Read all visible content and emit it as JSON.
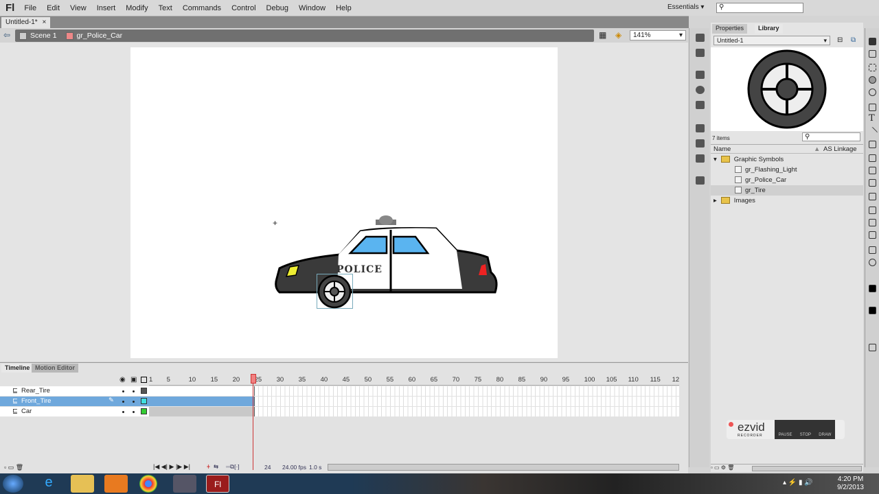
{
  "app": {
    "logo": "Fl",
    "menu": [
      "File",
      "Edit",
      "View",
      "Insert",
      "Modify",
      "Text",
      "Commands",
      "Control",
      "Debug",
      "Window",
      "Help"
    ],
    "workspace": "Essentials",
    "search_placeholder": ""
  },
  "document": {
    "tab": "Untitled-1*",
    "close": "×"
  },
  "editbar": {
    "scene": "Scene 1",
    "symbol": "gr_Police_Car",
    "zoom": "141%"
  },
  "stage": {
    "car_text": "POLICE"
  },
  "panel": {
    "tabs": [
      "Properties",
      "Library"
    ],
    "active_tab": "Library",
    "library_select": "Untitled-1",
    "item_count": "7 items",
    "columns": {
      "name": "Name",
      "linkage": "AS Linkage"
    },
    "items": [
      {
        "label": "Graphic Symbols",
        "type": "folder",
        "expanded": true
      },
      {
        "label": "gr_Flashing_Light",
        "type": "graphic"
      },
      {
        "label": "gr_Police_Car",
        "type": "graphic"
      },
      {
        "label": "gr_Tire",
        "type": "graphic",
        "selected": true
      },
      {
        "label": "Images",
        "type": "folder",
        "expanded": false
      }
    ]
  },
  "timeline": {
    "tabs": [
      "Timeline",
      "Motion Editor"
    ],
    "frame_numbers": [
      1,
      5,
      10,
      15,
      20,
      25,
      30,
      35,
      40,
      45,
      50,
      55,
      60,
      65,
      70,
      75,
      80,
      85,
      90,
      95,
      100,
      105,
      110,
      115,
      12
    ],
    "layers": [
      {
        "name": "Rear_Tire",
        "color": "#555555",
        "selected": false
      },
      {
        "name": "Front_Tire",
        "color": "#40e0e0",
        "selected": true
      },
      {
        "name": "Car",
        "color": "#33cc33",
        "selected": false
      }
    ],
    "current_frame": "24",
    "fps": "24.00 fps",
    "time": "1.0 s"
  },
  "ezvid": {
    "brand": "ezvid",
    "sub": "RECORDER",
    "buttons": [
      "PAUSE",
      "STOP",
      "DRAW"
    ]
  },
  "taskbar": {
    "time": "4:20 PM",
    "date": "9/2/2013"
  },
  "colors": {
    "accent": "#6fa8dc",
    "playhead": "#cc3333",
    "car_window": "#5ab4f0"
  }
}
